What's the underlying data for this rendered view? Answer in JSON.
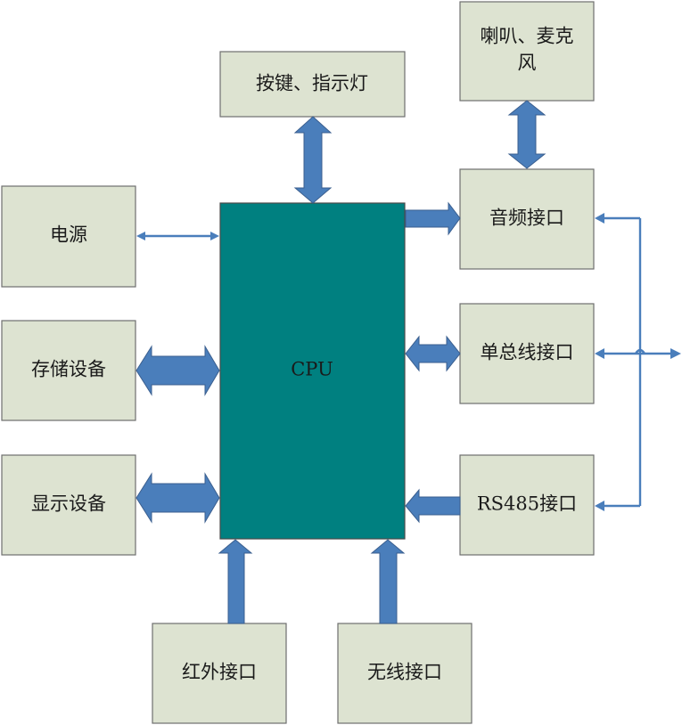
{
  "colors": {
    "box_fill": "#dde3d1",
    "cpu_fill": "#008080",
    "arrow": "#4a7ebb"
  },
  "cpu": {
    "label": "CPU"
  },
  "blocks": {
    "speaker_mic": {
      "line1": "喇叭、麦克",
      "line2": "风"
    },
    "keys_leds": "按键、指示灯",
    "power": "电源",
    "storage": "存储设备",
    "display": "显示设备",
    "audio_interface": "音频接口",
    "single_bus_interface": "单总线接口",
    "rs485_interface": "RS485接口",
    "infrared_interface": "红外接口",
    "wireless_interface": "无线接口"
  }
}
